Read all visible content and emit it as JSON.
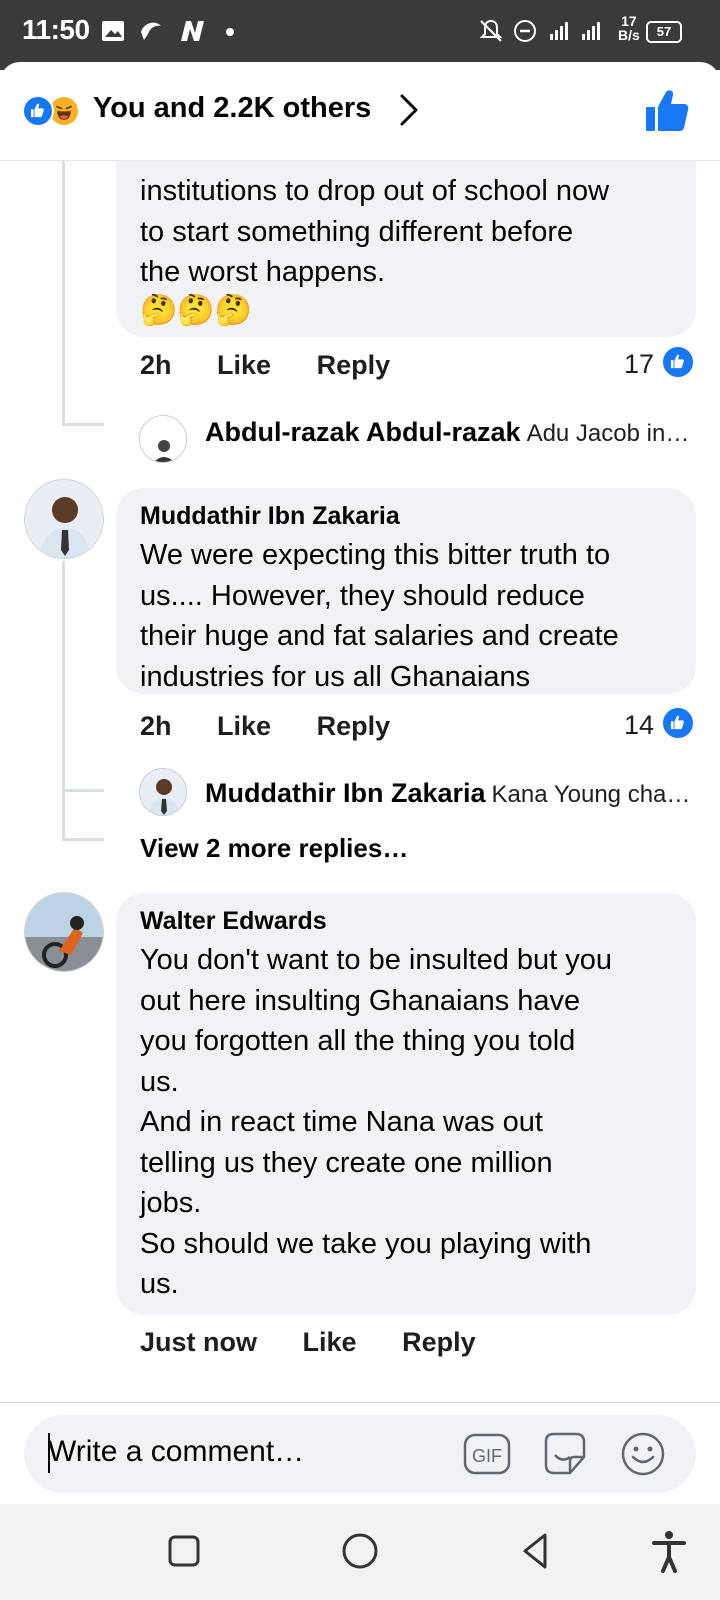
{
  "status_bar": {
    "time": "11:50",
    "speed_value": "17",
    "speed_unit": "B/s",
    "battery": "57"
  },
  "header": {
    "reactions_text": "You and 2.2K others"
  },
  "comments": [
    {
      "author": "",
      "text": "institutions to drop out of school now\nto start something different before\nthe worst happens.",
      "emoji": "🤔🤔🤔",
      "time": "2h",
      "like_label": "Like",
      "reply_label": "Reply",
      "like_count": "17",
      "reply_preview": {
        "author": "Abdul-razak Abdul-razak",
        "snippet": "Adu Jacob in…"
      }
    },
    {
      "author": "Muddathir Ibn Zakaria",
      "text": "We were expecting this bitter truth to\nus.... However, they should reduce\ntheir huge and fat salaries and create\nindustries for us all Ghanaians",
      "time": "2h",
      "like_label": "Like",
      "reply_label": "Reply",
      "like_count": "14",
      "reply_preview": {
        "author": "Muddathir Ibn Zakaria",
        "snippet": "Kana Young cha…"
      },
      "view_more": "View 2 more replies…"
    },
    {
      "author": "Walter Edwards",
      "text": "You don't want to be insulted but you\nout here  insulting Ghanaians have\nyou forgotten all the thing you told\nus.\nAnd in react time Nana was out\ntelling us they create one million\njobs.\nSo should we take you playing with\nus.",
      "time": "Just now",
      "like_label": "Like",
      "reply_label": "Reply"
    }
  ],
  "composer": {
    "placeholder": "Write a comment…",
    "gif_label": "GIF"
  },
  "colors": {
    "accent": "#1877f2",
    "bubble": "#f0f2f5",
    "status_bar": "#3a3a3a"
  },
  "icons": {
    "header": [
      "like-reaction-icon",
      "haha-reaction-icon",
      "chevron-right-icon",
      "thumbs-up-icon"
    ],
    "composer": [
      "gif-icon",
      "sticker-icon",
      "emoji-icon"
    ],
    "nav": [
      "recents-icon",
      "home-icon",
      "back-icon",
      "accessibility-icon"
    ]
  }
}
